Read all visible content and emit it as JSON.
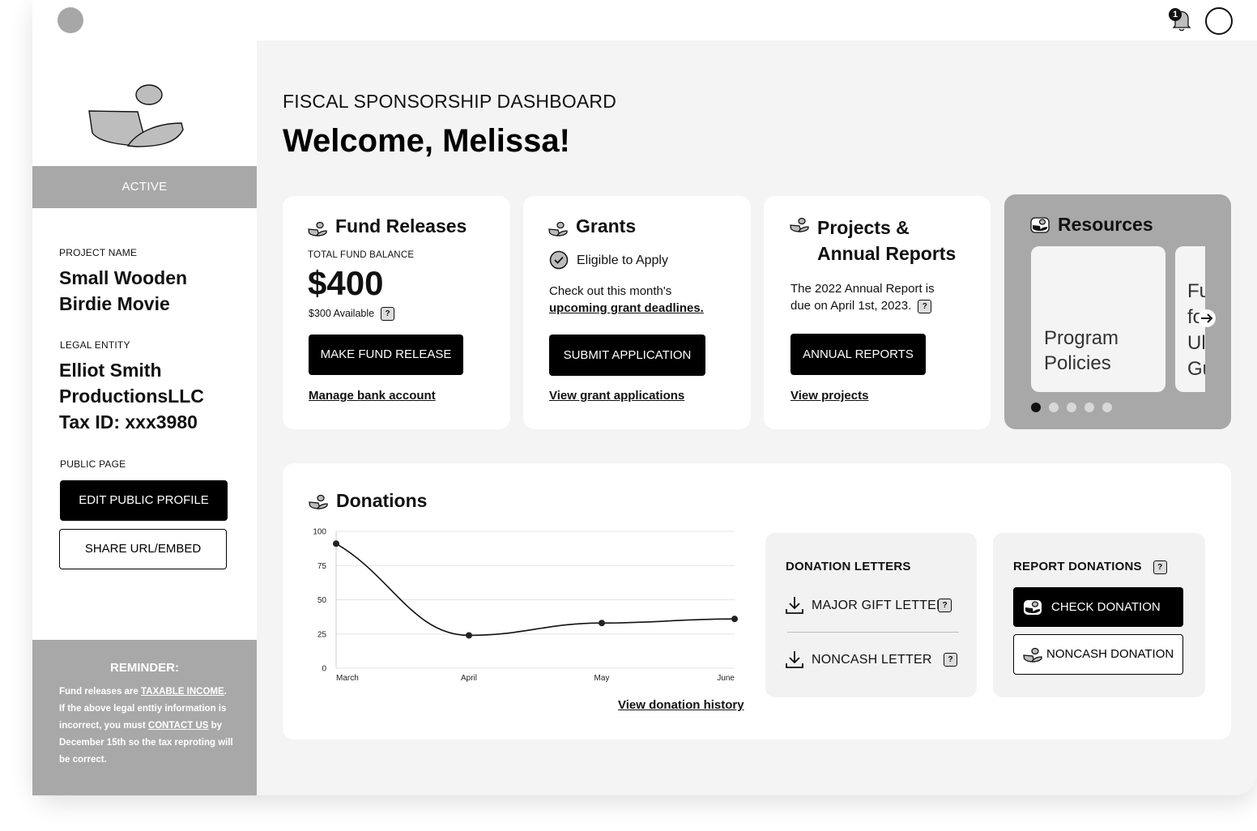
{
  "header": {
    "notification_count": "1"
  },
  "sidebar": {
    "status": "ACTIVE",
    "project_name_label": "PROJECT NAME",
    "project_name_line1": "Small Wooden",
    "project_name_line2": "Birdie Movie",
    "legal_entity_label": "LEGAL ENTITY",
    "legal_entity_line1": "Elliot Smith",
    "legal_entity_line2": "ProductionsLLC",
    "legal_entity_line3": "Tax ID: xxx3980",
    "public_page_label": "PUBLIC PAGE",
    "edit_profile_button": "EDIT PUBLIC PROFILE",
    "share_button": "SHARE URL/EMBED",
    "reminder_title": "REMINDER:",
    "reminder_text_1": "Fund releases are ",
    "reminder_link_1": "TAXABLE INCOME",
    "reminder_text_2": ". If the above legal enttiy information is incorrect, you must ",
    "reminder_link_2": "CONTACT US",
    "reminder_text_3": " by December 15th so the tax reproting will be correct."
  },
  "main": {
    "eyebrow": "FISCAL SPONSORSHIP DASHBOARD",
    "welcome": "Welcome, Melissa!"
  },
  "fund_releases": {
    "title": "Fund Releases",
    "balance_label": "TOTAL FUND BALANCE",
    "balance": "$400",
    "available": "$300 Available",
    "button": "MAKE FUND RELEASE",
    "link": "Manage bank account"
  },
  "grants": {
    "title": "Grants",
    "eligibility": "Eligible to Apply",
    "text": "Check out this month's",
    "deadlines_link": "upcoming grant deadlines.",
    "button": "SUBMIT APPLICATION",
    "link": "View grant applications"
  },
  "projects": {
    "title_line1": "Projects &",
    "title_line2": "Annual Reports",
    "text_line1": "The 2022 Annual Report is",
    "text_line2": "due on April 1st, 2023.",
    "button": "ANNUAL REPORTS",
    "link": "View projects"
  },
  "resources": {
    "title": "Resources",
    "tile1_line1": "Program",
    "tile1_line2": "Policies",
    "tile2_lines": [
      "Fu",
      "fo",
      "Ul",
      "Gu"
    ],
    "active_slide": 1,
    "slide_count": 5
  },
  "donations": {
    "title": "Donations",
    "history_link": "View donation history",
    "letters_title": "DONATION LETTERS",
    "major_gift_letter": "MAJOR GIFT LETTER",
    "noncash_letter": "NONCASH LETTER",
    "report_title": "REPORT DONATIONS",
    "check_button": "CHECK DONATION",
    "noncash_button": "NONCASH DONATION"
  },
  "chart_data": {
    "type": "line",
    "categories": [
      "March",
      "April",
      "May",
      "June"
    ],
    "values": [
      91,
      24,
      33,
      36
    ],
    "yticks": [
      0,
      25,
      50,
      75,
      100
    ],
    "ylim": [
      0,
      100
    ],
    "grid": true,
    "smooth": true
  },
  "colors": {
    "accent": "#000000",
    "muted": "#a8a8a8",
    "background": "#f4f4f4"
  }
}
